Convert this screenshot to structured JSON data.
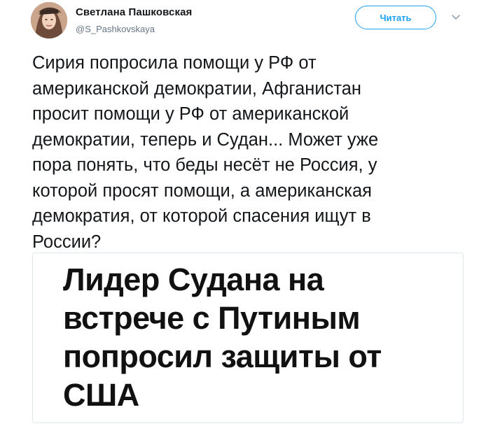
{
  "tweet": {
    "author": {
      "display_name": "Светлана Пашковская",
      "handle": "@S_Pashkovskaya",
      "avatar_icon": "user-avatar"
    },
    "follow_button_label": "Читать",
    "menu_icon": "chevron-down-icon",
    "text": "Сирия попросила помощи у РФ от\nамериканской демократии, Афганистан\nпросит помощи у РФ от американской\nдемократии, теперь и Судан... Может уже\nпора понять, что беды несёт не Россия, у\nкоторой просят помощи, а американская\nдемократия, от которой спасения ищут в\nРоссии?",
    "media_card": {
      "headline": "Лидер Судана на\nвстрече с Путиным\nпопросил защиты от\nСША"
    }
  },
  "colors": {
    "accent": "#1da1f2",
    "text": "#14171a",
    "secondary_text": "#657786",
    "border": "#e1e8ed"
  }
}
